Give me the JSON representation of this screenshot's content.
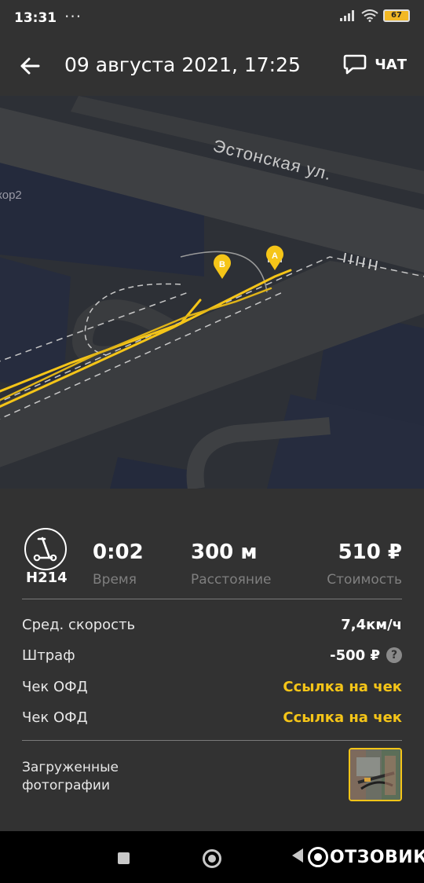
{
  "status_bar": {
    "time": "13:31",
    "overflow": "···",
    "battery": "67",
    "icons": [
      "signal-icon",
      "wifi-icon",
      "battery-icon"
    ]
  },
  "header": {
    "title": "09 августа 2021, 17:25",
    "chat_label": "ЧАТ",
    "icons": [
      "back-arrow-icon",
      "chat-bubble-icon"
    ]
  },
  "map": {
    "street_label": "Эстонская ул.",
    "partial_label": "кор2",
    "start_marker": "A",
    "end_marker": "B",
    "colors": {
      "route": "#f5c518",
      "background": "#2d3036",
      "building": "#242a3c",
      "road": "#3e4043"
    }
  },
  "trip": {
    "scooter_id": "H214",
    "duration": "0:02",
    "duration_label": "Время",
    "distance": "300 м",
    "distance_label": "Расстояние",
    "cost": "510 ₽",
    "cost_label": "Стоимость"
  },
  "details": {
    "avg_speed_label": "Сред. скорость",
    "avg_speed_value": "7,4км/ч",
    "fine_label": "Штраф",
    "fine_value": "-500 ₽",
    "fine_help": "?",
    "receipt1_label": "Чек ОФД",
    "receipt1_link": "Ссылка на чек",
    "receipt2_label": "Чек ОФД",
    "receipt2_link": "Ссылка на чек",
    "photos_label_line1": "Загруженные",
    "photos_label_line2": "фотографии"
  },
  "watermark": {
    "text": "ОТЗОВИК"
  },
  "colors": {
    "accent": "#f5c518",
    "panel": "#323232",
    "muted": "#7f7f7f"
  }
}
